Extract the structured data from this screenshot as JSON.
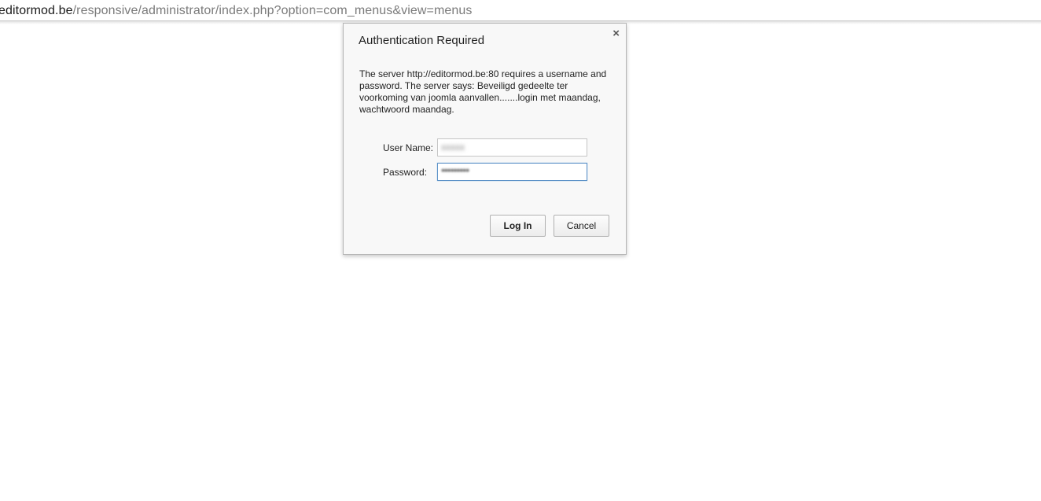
{
  "address_bar": {
    "host": "editormod.be",
    "path": "/responsive/administrator/index.php?option=com_menus&view=menus"
  },
  "dialog": {
    "title": "Authentication Required",
    "close_symbol": "×",
    "message": "The server http://editormod.be:80 requires a username and password. The server says: Beveiligd gedeelte ter voorkoming van joomla aanvallen.......login met maandag, wachtwoord maandag.",
    "username_label": "User Name:",
    "username_value": "xxxxx",
    "password_label": "Password:",
    "password_mask": "•••••••••",
    "login_label": "Log In",
    "cancel_label": "Cancel"
  },
  "colors": {
    "focus_border": "#5e93c8",
    "dialog_bg": "#f8f8f8"
  },
  "icons": {
    "close": "close-icon"
  }
}
